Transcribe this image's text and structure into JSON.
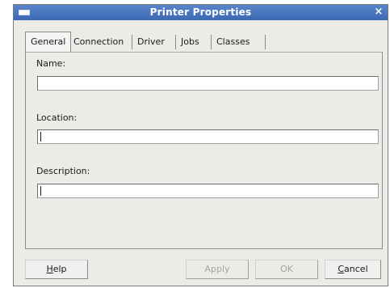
{
  "window": {
    "title": "Printer Properties",
    "close_glyph": "×"
  },
  "tabs": [
    {
      "label": "General",
      "selected": true
    },
    {
      "label": "Connection",
      "selected": false
    },
    {
      "label": "Driver",
      "selected": false
    },
    {
      "label": "Jobs",
      "selected": false
    },
    {
      "label": "Classes",
      "selected": false
    }
  ],
  "general": {
    "name_label": "Name:",
    "name_value": "",
    "location_label": "Location:",
    "location_value": "",
    "description_label": "Description:",
    "description_value": ""
  },
  "buttons": {
    "help": {
      "mnemonic": "H",
      "rest": "elp",
      "enabled": true
    },
    "apply": {
      "label": "Apply",
      "enabled": false
    },
    "ok": {
      "label": "OK",
      "enabled": false
    },
    "cancel": {
      "mnemonic": "C",
      "rest": "ancel",
      "enabled": true
    }
  },
  "colors": {
    "titlebar": "#3a68b3",
    "window_bg": "#ecebe8"
  }
}
